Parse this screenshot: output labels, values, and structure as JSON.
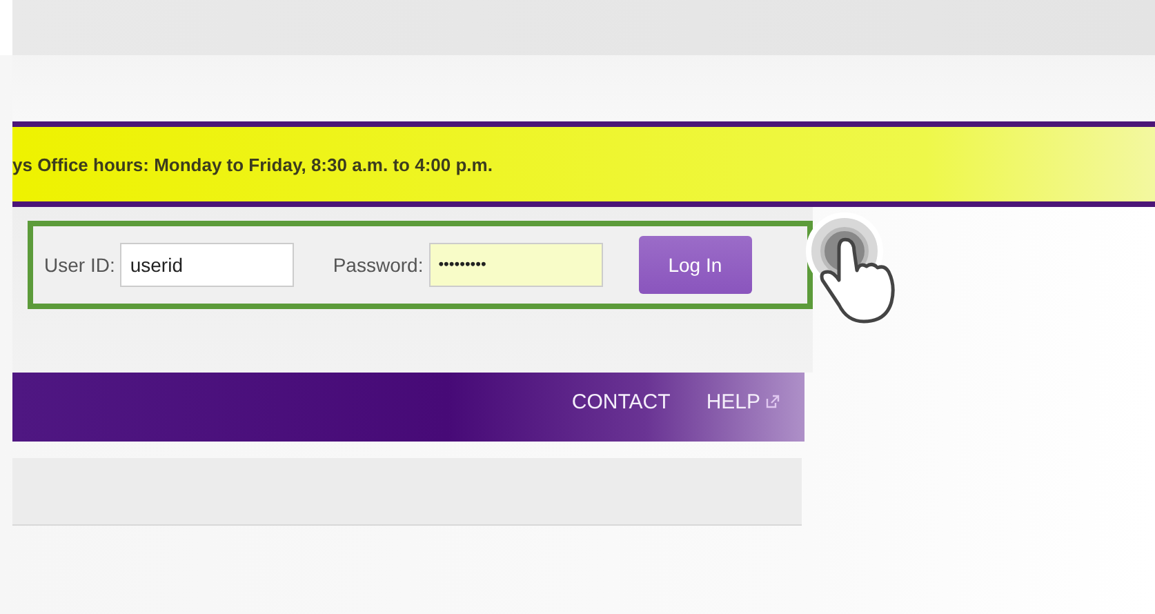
{
  "banner": {
    "text": "ys Office hours: Monday to Friday, 8:30 a.m. to 4:00 p.m."
  },
  "login": {
    "user_label": "User ID:",
    "user_value": "userid",
    "password_label": "Password:",
    "password_value": "•••••••••",
    "button": "Log In"
  },
  "nav": {
    "links": [
      {
        "label": "CONTACT",
        "external": false
      },
      {
        "label": "HELP",
        "external": true
      }
    ]
  }
}
